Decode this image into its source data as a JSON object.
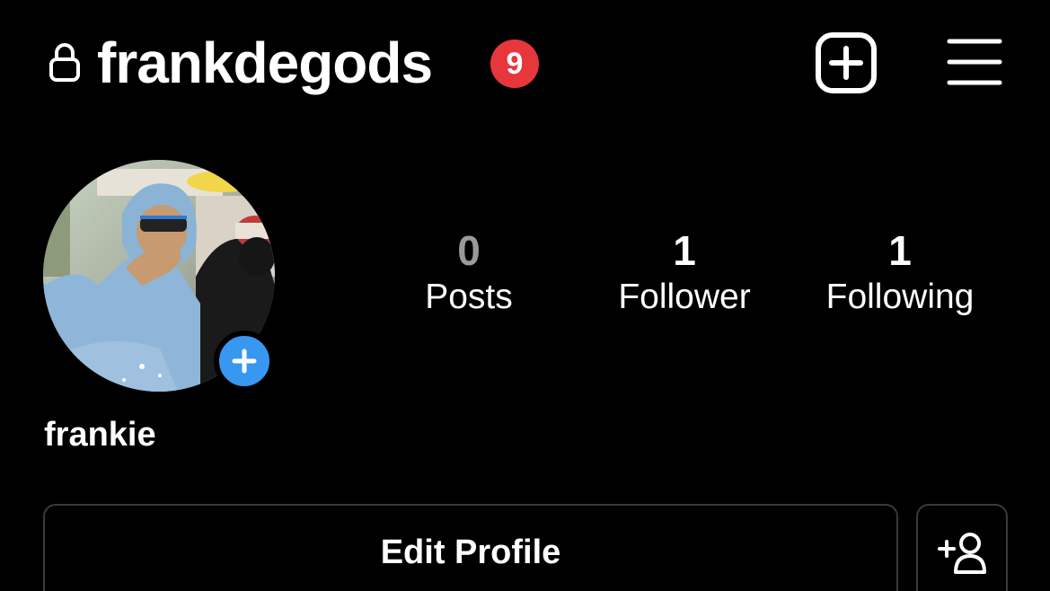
{
  "header": {
    "username": "frankdegods",
    "notification_count": "9",
    "lock_icon": "lock-icon",
    "create_icon": "plus-square-icon",
    "menu_icon": "hamburger-menu-icon"
  },
  "profile": {
    "display_name": "frankie",
    "avatar_add_icon": "plus-icon"
  },
  "stats": [
    {
      "count": "0",
      "label": "Posts"
    },
    {
      "count": "1",
      "label": "Follower"
    },
    {
      "count": "1",
      "label": "Following"
    }
  ],
  "actions": {
    "edit_profile_label": "Edit Profile",
    "add_person_icon": "add-person-icon"
  },
  "colors": {
    "background": "#000000",
    "badge": "#e8363d",
    "story_add": "#3897f0",
    "border": "#3a3a3a",
    "muted": "#9a9a9a"
  }
}
